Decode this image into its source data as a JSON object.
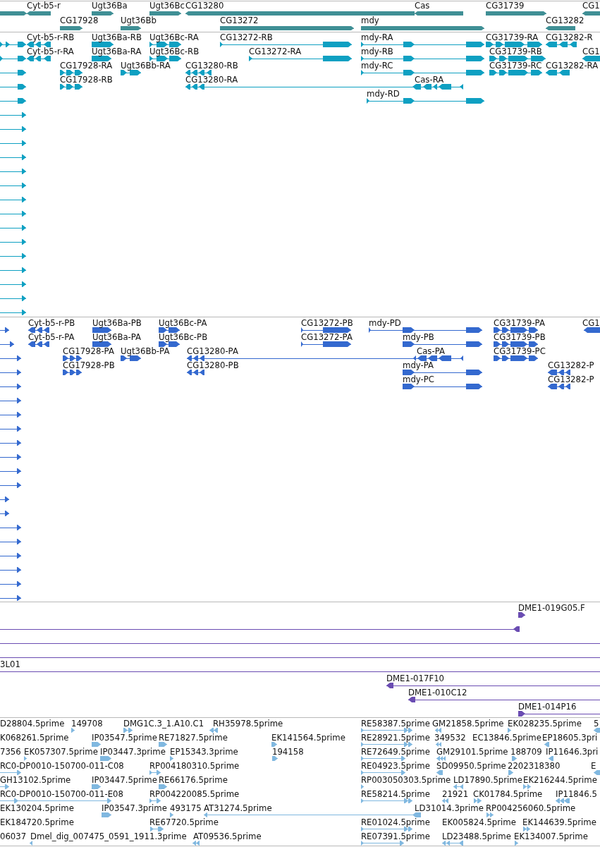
{
  "tracks": [
    {
      "kind": "gene",
      "rows": [
        {
          "features": [
            {
              "reverse": false
            },
            {
              "label": "Cyt-b5-r",
              "reverse": true
            },
            {
              "label": "Ugt36Ba",
              "reverse": false
            },
            {
              "label": "Ugt36Bc",
              "reverse": false
            },
            {
              "label": "CG13280",
              "reverse": true
            },
            {
              "label": "Cas",
              "reverse": true
            },
            {
              "label": "CG31739",
              "reverse": false
            },
            {
              "label": "CG1",
              "reverse": true
            }
          ]
        },
        {
          "features": [
            {
              "label": "CG17928",
              "reverse": false
            },
            {
              "label": "Ugt36Bb",
              "reverse": false
            },
            {
              "label": "CG13272",
              "reverse": false
            },
            {
              "label": "mdy",
              "reverse": false
            },
            {
              "label": "CG13282",
              "reverse": true
            }
          ]
        }
      ]
    },
    {
      "kind": "transcript",
      "rows": [
        {
          "features": [
            {
              "reverse": false
            },
            {
              "label": "Cyt-b5-r-RB",
              "reverse": true
            },
            {
              "label": "Ugt36Ba-RB",
              "reverse": false
            },
            {
              "label": "Ugt36Bc-RA",
              "reverse": false
            },
            {
              "label": "CG13272-RB",
              "reverse": false
            },
            {
              "label": "mdy-RA",
              "reverse": false
            },
            {
              "label": "CG31739-RA",
              "reverse": false
            },
            {
              "label": "CG13282-R",
              "reverse": true
            }
          ]
        },
        {
          "features": [
            {
              "reverse": false
            },
            {
              "label": "Cyt-b5-r-RA",
              "reverse": true
            },
            {
              "label": "Ugt36Ba-RA",
              "reverse": false
            },
            {
              "label": "Ugt36Bc-RB",
              "reverse": false
            },
            {
              "label": "CG13272-RA",
              "reverse": false
            },
            {
              "label": "mdy-RB",
              "reverse": false
            },
            {
              "label": "CG31739-RB",
              "reverse": false
            },
            {
              "label": "CG1",
              "reverse": true
            }
          ]
        },
        {
          "features": [
            {
              "reverse": false
            },
            {
              "label": "CG17928-RA",
              "reverse": false
            },
            {
              "label": "Ugt36Bb-RA",
              "reverse": false
            },
            {
              "label": "CG13280-RB",
              "reverse": true
            },
            {
              "label": "mdy-RC",
              "reverse": false
            },
            {
              "label": "CG31739-RC",
              "reverse": false
            },
            {
              "label": "CG13282-RA",
              "reverse": true
            }
          ]
        },
        {
          "features": [
            {
              "reverse": false
            },
            {
              "label": "CG17928-RB",
              "reverse": false
            },
            {
              "label": "CG13280-RA",
              "reverse": true
            },
            {
              "label": "Cas-RA",
              "reverse": true
            }
          ]
        },
        {
          "features": [
            {
              "reverse": false
            },
            {
              "label": "mdy-RD",
              "reverse": false
            }
          ]
        },
        {
          "features": [
            {
              "reverse": false
            }
          ]
        },
        {
          "features": [
            {
              "reverse": false
            }
          ]
        },
        {
          "features": [
            {
              "reverse": false
            }
          ]
        },
        {
          "features": [
            {
              "reverse": false
            }
          ]
        },
        {
          "features": [
            {
              "reverse": false
            }
          ]
        },
        {
          "features": [
            {
              "reverse": false
            }
          ]
        },
        {
          "features": [
            {
              "reverse": false
            }
          ]
        },
        {
          "features": [
            {
              "reverse": false
            }
          ]
        },
        {
          "features": [
            {
              "reverse": false
            }
          ]
        },
        {
          "features": [
            {
              "reverse": false
            }
          ]
        },
        {
          "features": [
            {
              "reverse": false
            }
          ]
        },
        {
          "features": [
            {
              "reverse": false
            }
          ]
        },
        {
          "features": [
            {
              "reverse": false
            }
          ]
        },
        {
          "features": [
            {
              "reverse": false
            }
          ]
        },
        {
          "features": [
            {
              "reverse": false
            }
          ]
        }
      ]
    },
    {
      "kind": "protein",
      "rows": [
        {
          "features": [
            {
              "reverse": false
            },
            {
              "label": "Cyt-b5-r-PB",
              "reverse": true
            },
            {
              "label": "Ugt36Ba-PB",
              "reverse": false
            },
            {
              "label": "Ugt36Bc-PA",
              "reverse": false
            },
            {
              "label": "CG13272-PB",
              "reverse": false
            },
            {
              "label": "mdy-PD",
              "reverse": false
            },
            {
              "label": "CG31739-PA",
              "reverse": false
            },
            {
              "label": "CG1",
              "reverse": true
            }
          ]
        },
        {
          "features": [
            {
              "reverse": false
            },
            {
              "label": "Cyt-b5-r-PA",
              "reverse": true
            },
            {
              "label": "Ugt36Ba-PA",
              "reverse": false
            },
            {
              "label": "Ugt36Bc-PB",
              "reverse": false
            },
            {
              "label": "CG13272-PA",
              "reverse": false
            },
            {
              "label": "mdy-PB",
              "reverse": false
            },
            {
              "label": "CG31739-PB",
              "reverse": false
            }
          ]
        },
        {
          "features": [
            {
              "reverse": false
            },
            {
              "label": "CG17928-PA",
              "reverse": false
            },
            {
              "label": "Ugt36Bb-PA",
              "reverse": false
            },
            {
              "label": "CG13280-PA",
              "reverse": true
            },
            {
              "label": "Cas-PA",
              "reverse": true
            },
            {
              "label": "CG31739-PC",
              "reverse": false
            }
          ]
        },
        {
          "features": [
            {
              "reverse": false
            },
            {
              "label": "CG17928-PB",
              "reverse": false
            },
            {
              "label": "CG13280-PB",
              "reverse": true
            },
            {
              "label": "mdy-PA",
              "reverse": false
            },
            {
              "label": "CG13282-P",
              "reverse": true
            }
          ]
        },
        {
          "features": [
            {
              "reverse": false
            },
            {
              "label": "mdy-PC",
              "reverse": false
            },
            {
              "label": "CG13282-P",
              "reverse": true
            }
          ]
        },
        {
          "features": [
            {
              "reverse": false
            }
          ]
        },
        {
          "features": [
            {
              "reverse": false
            }
          ]
        },
        {
          "features": [
            {
              "reverse": false
            }
          ]
        },
        {
          "features": [
            {
              "reverse": false
            }
          ]
        },
        {
          "features": [
            {
              "reverse": false
            }
          ]
        },
        {
          "features": [
            {
              "reverse": false
            }
          ]
        },
        {
          "features": [
            {
              "reverse": false
            }
          ]
        },
        {
          "features": [
            {
              "reverse": false
            }
          ]
        },
        {
          "features": [
            {
              "reverse": false
            }
          ]
        },
        {
          "features": [
            {
              "reverse": false
            }
          ]
        },
        {
          "features": [
            {
              "reverse": false
            }
          ]
        },
        {
          "features": [
            {
              "reverse": false
            }
          ]
        },
        {
          "features": [
            {
              "reverse": false
            }
          ]
        },
        {
          "features": [
            {
              "reverse": false
            }
          ]
        },
        {
          "features": [
            {
              "reverse": false
            }
          ]
        }
      ]
    },
    {
      "kind": "clone",
      "rows": [
        {
          "features": [
            {
              "kind": "clone",
              "label": "DME1-019G05.F",
              "reverse": false
            }
          ]
        },
        {
          "features": [
            {
              "kind": "clone",
              "reverse": true
            }
          ]
        },
        {
          "features": [
            {
              "kind": "span"
            }
          ]
        },
        {
          "features": [
            {
              "kind": "span"
            }
          ]
        },
        {
          "features": [
            {
              "kind": "span",
              "label": "3L01"
            }
          ]
        },
        {
          "features": [
            {
              "kind": "clone",
              "label": "DME1-017F10",
              "reverse": true
            }
          ]
        },
        {
          "features": [
            {
              "kind": "clone",
              "label": "DME1-010C12",
              "reverse": true
            }
          ]
        },
        {
          "features": [
            {
              "kind": "clone",
              "label": "DME1-014P16",
              "reverse": false
            }
          ]
        }
      ]
    },
    {
      "kind": "est",
      "rows": [
        {
          "features": [
            {
              "label": "D28804.5prime"
            },
            {
              "label": "149708",
              "reverse": false
            },
            {
              "label": "DMG1C.3_1.A10.C1",
              "reverse": false
            },
            {
              "label": "RH35978.5prime",
              "reverse": true
            },
            {
              "label": "RE58387.5prime",
              "reverse": false
            },
            {
              "label": "GM21858.5prime",
              "reverse": true
            },
            {
              "label": "EK028235.5prime",
              "reverse": false
            },
            {
              "label": "5",
              "reverse": true
            }
          ]
        },
        {
          "features": [
            {
              "label": "K068261.5prime"
            },
            {
              "label": "IP03547.5prime",
              "reverse": false
            },
            {
              "label": "RE71827.5prime",
              "reverse": false
            },
            {
              "label": "EK141564.5prime",
              "reverse": false
            },
            {
              "label": "RE28921.5prime",
              "reverse": false
            },
            {
              "label": "349532",
              "reverse": true
            },
            {
              "label": "EC13846.5prime"
            },
            {
              "label": "EP18605.3pri",
              "reverse": true
            }
          ]
        },
        {
          "features": [
            {
              "label": "7356"
            },
            {
              "label": "EK057307.5prime",
              "reverse": false
            },
            {
              "label": "IP03447.3prime",
              "reverse": false
            },
            {
              "label": "EP15343.3prime",
              "reverse": false
            },
            {
              "label": "194158",
              "reverse": false
            },
            {
              "label": "RE72649.5prime",
              "reverse": false
            },
            {
              "label": "GM29101.5prime",
              "reverse": true
            },
            {
              "label": "188709",
              "reverse": false
            },
            {
              "label": "IP11646.3pri",
              "reverse": true
            }
          ]
        },
        {
          "features": [
            {
              "label": "RC0-DP0010-150700-011-C08",
              "reverse": false
            },
            {
              "label": "RP004180310.5prime",
              "reverse": false
            },
            {
              "label": "RE04923.5prime",
              "reverse": false
            },
            {
              "label": "SD09950.5prime",
              "reverse": true
            },
            {
              "label": "2202318380",
              "reverse": false
            },
            {
              "label": "E",
              "reverse": true
            }
          ]
        },
        {
          "features": [
            {
              "label": "GH13102.5prime",
              "reverse": false
            },
            {
              "label": "IP03447.5prime",
              "reverse": false
            },
            {
              "label": "RE66176.5prime",
              "reverse": false
            },
            {
              "label": "RP003050303.5prime",
              "reverse": false
            },
            {
              "label": "LD17890.5prime",
              "reverse": true
            },
            {
              "label": "EK216244.5prime",
              "reverse": false
            }
          ]
        },
        {
          "features": [
            {
              "label": "RC0-DP0010-150700-011-E08",
              "reverse": false
            },
            {
              "label": "RP004220085.5prime",
              "reverse": false
            },
            {
              "label": "RE58214.5prime",
              "reverse": false
            },
            {
              "label": "21921",
              "reverse": true
            },
            {
              "label": "CK01784.5prime",
              "reverse": false
            },
            {
              "label": "IP11846.5",
              "reverse": true
            }
          ]
        },
        {
          "features": [
            {
              "label": "EK130204.5prime"
            },
            {
              "label": "IP03547.3prime",
              "reverse": false
            },
            {
              "label": "493175",
              "reverse": false
            },
            {
              "label": "AT31274.5prime",
              "reverse": true
            },
            {
              "label": "LD31014.3prime",
              "reverse": true
            },
            {
              "label": "RP004256060.5prime",
              "reverse": false
            }
          ]
        },
        {
          "features": [
            {
              "label": "EK184720.5prime"
            },
            {
              "label": "RE67720.5prime",
              "reverse": false
            },
            {
              "label": "RE01024.5prime",
              "reverse": false
            },
            {
              "label": "EK005824.5prime"
            },
            {
              "label": "EK144639.5prime",
              "reverse": false
            }
          ]
        },
        {
          "features": [
            {
              "label": "06037"
            },
            {
              "label": "Dmel_dig_007475_0591_1911.3prime",
              "reverse": true
            },
            {
              "label": "AT09536.5prime",
              "reverse": true
            },
            {
              "label": "RE07391.5prime",
              "reverse": false
            },
            {
              "label": "LD23488.5prime",
              "reverse": true
            },
            {
              "label": "EK134007.5prime",
              "reverse": false
            }
          ]
        }
      ]
    }
  ]
}
